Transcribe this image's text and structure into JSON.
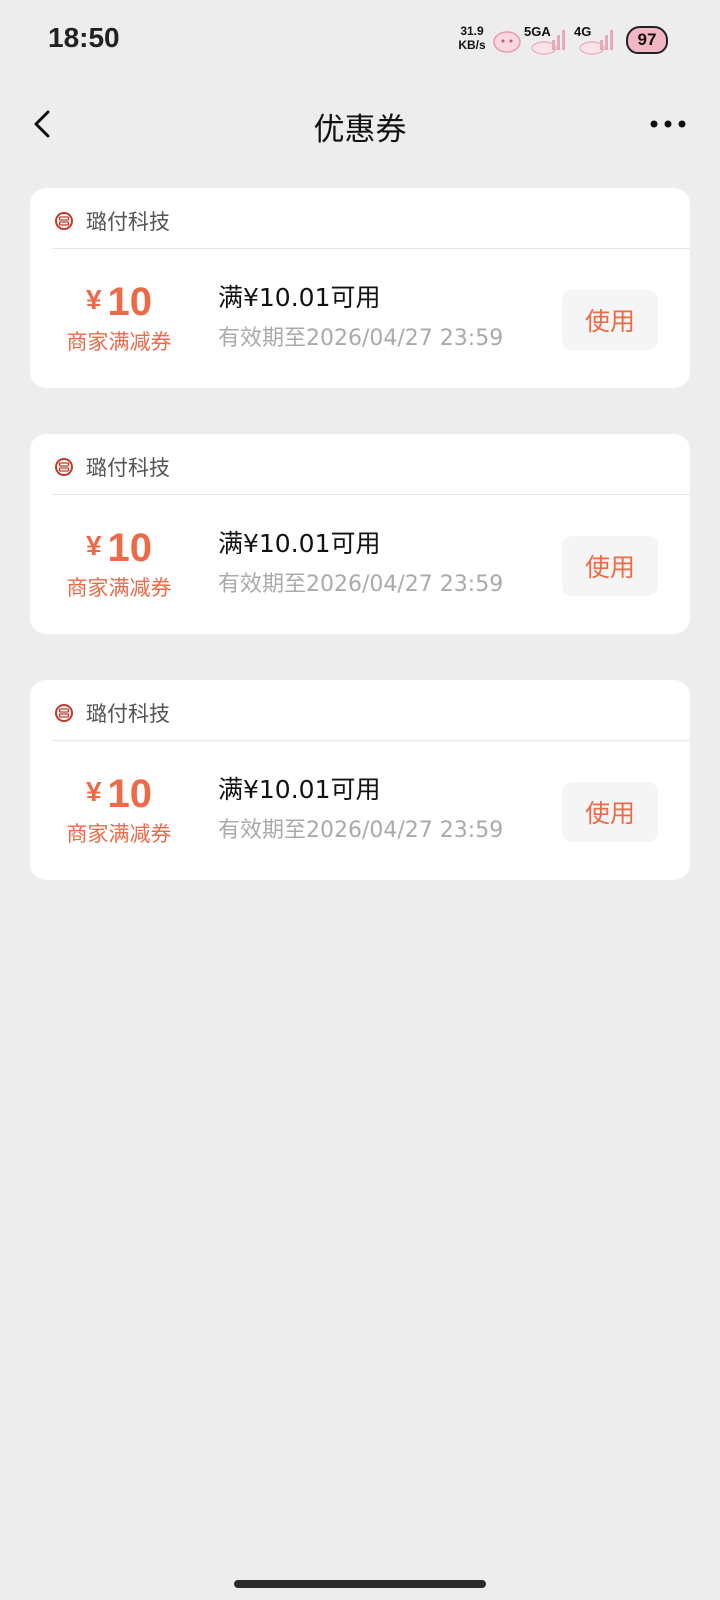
{
  "status_bar": {
    "time": "18:50",
    "net_speed_value": "31.9",
    "net_speed_unit": "KB/s",
    "signal1_label": "5GA",
    "signal2_label": "4G",
    "battery": "97"
  },
  "header": {
    "title": "优惠券",
    "back_icon": "chevron-left-icon",
    "more_icon": "more-dots-icon"
  },
  "colors": {
    "accent": "#ec6a48",
    "background": "#ededed",
    "card": "#ffffff"
  },
  "coupons": [
    {
      "merchant": "璐付科技",
      "currency": "¥",
      "amount": "10",
      "type": "商家满减券",
      "condition": "满¥10.01可用",
      "validity": "有效期至2026/04/27 23:59",
      "button": "使用"
    },
    {
      "merchant": "璐付科技",
      "currency": "¥",
      "amount": "10",
      "type": "商家满减券",
      "condition": "满¥10.01可用",
      "validity": "有效期至2026/04/27 23:59",
      "button": "使用"
    },
    {
      "merchant": "璐付科技",
      "currency": "¥",
      "amount": "10",
      "type": "商家满减券",
      "condition": "满¥10.01可用",
      "validity": "有效期至2026/04/27 23:59",
      "button": "使用"
    }
  ]
}
